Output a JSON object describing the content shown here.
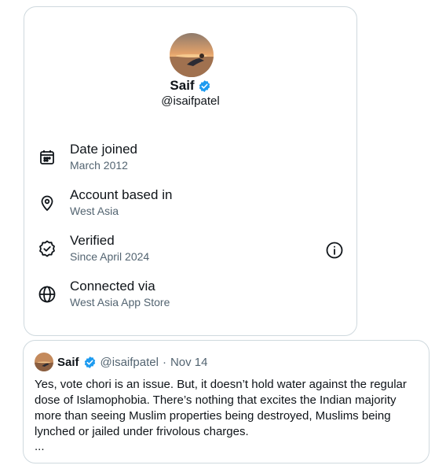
{
  "profile": {
    "name": "Saif",
    "handle": "@isaifpatel",
    "verified_color": "#1d9bf0"
  },
  "about_rows": [
    {
      "icon": "calendar-icon",
      "title": "Date joined",
      "subtitle": "March 2012"
    },
    {
      "icon": "location-pin-icon",
      "title": "Account based in",
      "subtitle": "West Asia"
    },
    {
      "icon": "verified-badge-outline-icon",
      "title": "Verified",
      "subtitle": "Since April 2024"
    },
    {
      "icon": "globe-icon",
      "title": "Connected via",
      "subtitle": "West Asia App Store"
    }
  ],
  "quote": {
    "name": "Saif",
    "handle": "@isaifpatel",
    "separator": "·",
    "date": "Nov 14",
    "text": "Yes, vote chori is an issue. But, it doesn’t hold water against the regular dose of Islamophobia. There’s nothing that excites the Indian majority more than seeing Muslim properties being destroyed, Muslims being lynched or jailed under frivolous charges.",
    "ellipsis": "..."
  }
}
